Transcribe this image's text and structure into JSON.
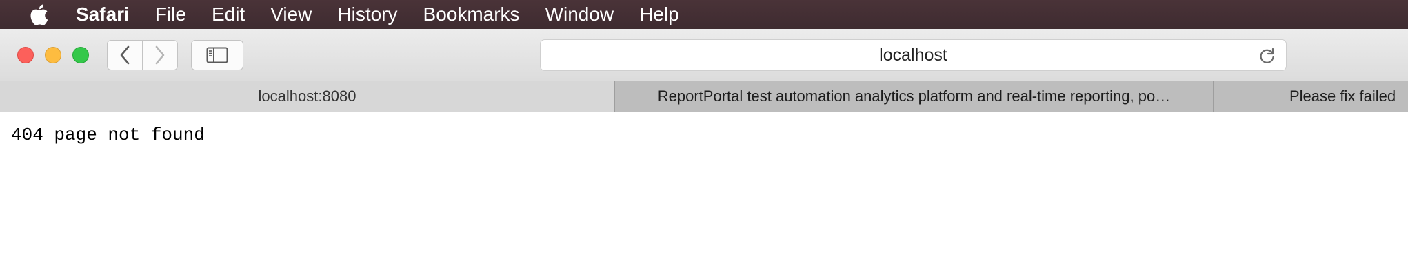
{
  "menubar": {
    "apple_icon": "apple-logo-icon",
    "items": [
      "Safari",
      "File",
      "Edit",
      "View",
      "History",
      "Bookmarks",
      "Window",
      "Help"
    ]
  },
  "toolbar": {
    "address": "localhost",
    "back_icon": "chevron-left-icon",
    "forward_icon": "chevron-right-icon",
    "sidebar_icon": "sidebar-icon",
    "reload_icon": "reload-icon"
  },
  "tabs": [
    {
      "title": "localhost:8080",
      "active": true
    },
    {
      "title": "ReportPortal test automation analytics platform and real-time reporting, po…",
      "active": false
    },
    {
      "title": "Please fix failed",
      "active": false
    }
  ],
  "page": {
    "text": "404 page not found"
  },
  "colors": {
    "menubar": "#3e2b30",
    "close": "#fc605b",
    "minimize": "#fdbc40",
    "zoom": "#34c84a"
  }
}
